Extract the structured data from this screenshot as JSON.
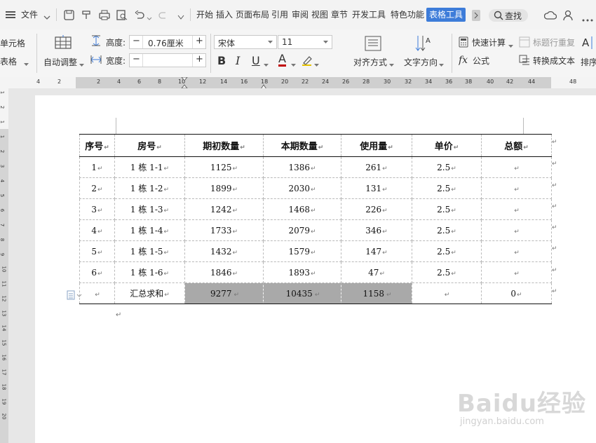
{
  "menu": {
    "file_label": "文件",
    "tabs": [
      "开始",
      "插入",
      "页面布局",
      "引用",
      "审阅",
      "视图",
      "章节",
      "开发工具",
      "特色功能",
      "表格工具"
    ],
    "active_tab": "表格工具",
    "search_label": "查找"
  },
  "toolbar": {
    "cell_label": "单元格",
    "table_label": "表格",
    "auto_adjust": "自动调整",
    "height_label": "高度:",
    "height_value": "0.76厘米",
    "width_label": "宽度:",
    "width_value": "",
    "font_name": "宋体",
    "font_size": "11",
    "bold": "B",
    "italic": "I",
    "underline": "U",
    "font_color": "A",
    "align_label": "对齐方式",
    "text_dir_label": "文字方向",
    "quick_calc": "快速计算",
    "title_repeat": "标题行重复",
    "formula": "公式",
    "convert_text": "转换成文本",
    "sort_label": "排序",
    "minus": "−",
    "plus": "+"
  },
  "ruler": {
    "numbers": [
      "4",
      "2",
      "2",
      "4",
      "6",
      "8",
      "10",
      "12",
      "14",
      "16",
      "18",
      "20",
      "22",
      "24",
      "26",
      "28",
      "30",
      "32",
      "34",
      "36",
      "38",
      "40",
      "42",
      "44",
      "48"
    ]
  },
  "vruler": {
    "numbers": [
      "1",
      "2",
      "1",
      "1",
      "2",
      "3",
      "4",
      "5",
      "6",
      "7",
      "8",
      "9",
      "10",
      "11",
      "12",
      "13",
      "14",
      "15",
      "16",
      "17",
      "18",
      "19",
      "20"
    ]
  },
  "table": {
    "headers": [
      "序号",
      "房号",
      "期初数量",
      "本期数量",
      "使用量",
      "单价",
      "总额"
    ],
    "rows": [
      [
        "1",
        "1 栋 1-1",
        "1125",
        "1386",
        "261",
        "2.5",
        ""
      ],
      [
        "2",
        "1 栋 1-2",
        "1899",
        "2030",
        "131",
        "2.5",
        ""
      ],
      [
        "3",
        "1 栋 1-3",
        "1242",
        "1468",
        "226",
        "2.5",
        ""
      ],
      [
        "4",
        "1 栋 1-4",
        "1733",
        "2079",
        "346",
        "2.5",
        ""
      ],
      [
        "5",
        "1 栋 1-5",
        "1432",
        "1579",
        "147",
        "2.5",
        ""
      ],
      [
        "6",
        "1 栋 1-6",
        "1846",
        "1893",
        "47",
        "2.5",
        ""
      ]
    ],
    "total_row": [
      "",
      "汇总求和",
      "9277",
      "10435",
      "1158",
      "",
      "0"
    ]
  },
  "watermark": {
    "logo": "Baidu经验",
    "url": "jingyan.baidu.com"
  },
  "colors": {
    "accent": "#3d7cd9",
    "highlight": "#a9a9a9"
  }
}
